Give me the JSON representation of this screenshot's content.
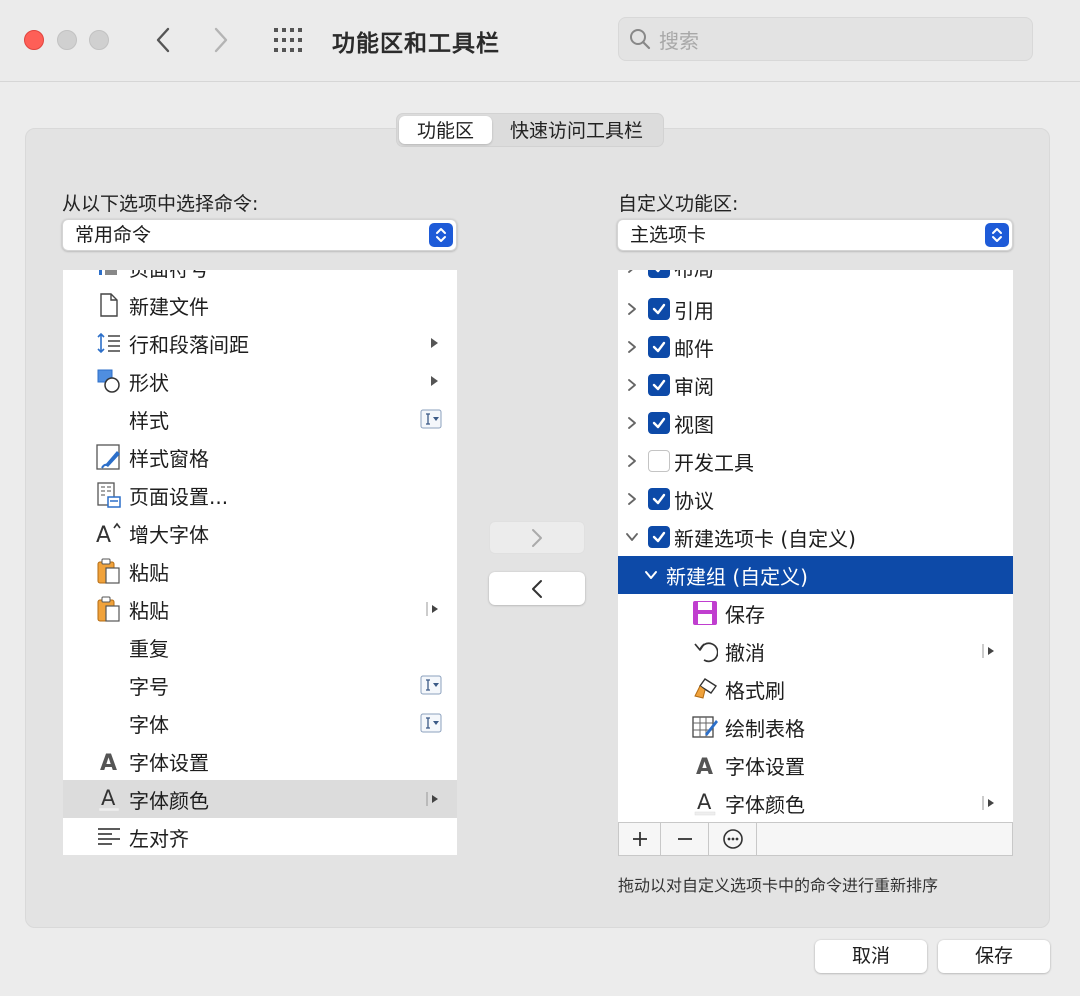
{
  "window": {
    "title": "功能区和工具栏",
    "search_placeholder": "搜索"
  },
  "tabs": [
    {
      "label": "功能区",
      "active": true
    },
    {
      "label": "快速访问工具栏",
      "active": false
    }
  ],
  "left": {
    "label": "从以下选项中选择命令:",
    "popup_value": "常用命令",
    "partial_top_item": "页面符号",
    "items": [
      {
        "label": "新建文件",
        "icon": "new-file-icon",
        "trailing": ""
      },
      {
        "label": "行和段落间距",
        "icon": "line-spacing-icon",
        "trailing": "submenu"
      },
      {
        "label": "形状",
        "icon": "shapes-icon",
        "trailing": "submenu"
      },
      {
        "label": "样式",
        "icon": "",
        "trailing": "combo"
      },
      {
        "label": "样式窗格",
        "icon": "styles-pane-icon",
        "trailing": ""
      },
      {
        "label": "页面设置...",
        "icon": "page-setup-icon",
        "trailing": ""
      },
      {
        "label": "增大字体",
        "icon": "grow-font-icon",
        "trailing": ""
      },
      {
        "label": "粘贴",
        "icon": "paste-icon",
        "trailing": ""
      },
      {
        "label": "粘贴",
        "icon": "paste-icon",
        "trailing": "split"
      },
      {
        "label": "重复",
        "icon": "",
        "trailing": ""
      },
      {
        "label": "字号",
        "icon": "",
        "trailing": "combo"
      },
      {
        "label": "字体",
        "icon": "",
        "trailing": "combo"
      },
      {
        "label": "字体设置",
        "icon": "font-settings-icon",
        "trailing": ""
      },
      {
        "label": "字体颜色",
        "icon": "font-color-icon",
        "trailing": "split",
        "highlighted": true
      },
      {
        "label": "左对齐",
        "icon": "align-left-icon",
        "trailing": ""
      }
    ]
  },
  "right": {
    "label": "自定义功能区:",
    "popup_value": "主选项卡",
    "partial_top_item": "布局",
    "tabs": [
      {
        "label": "引用",
        "checked": true
      },
      {
        "label": "邮件",
        "checked": true
      },
      {
        "label": "审阅",
        "checked": true
      },
      {
        "label": "视图",
        "checked": true
      },
      {
        "label": "开发工具",
        "checked": false
      },
      {
        "label": "协议",
        "checked": true
      },
      {
        "label": "新建选项卡 (自定义)",
        "checked": true,
        "expanded": true
      }
    ],
    "group_label": "新建组 (自定义)",
    "commands": [
      {
        "label": "保存",
        "icon": "save-icon",
        "trailing": ""
      },
      {
        "label": "撤消",
        "icon": "undo-icon",
        "trailing": "split"
      },
      {
        "label": "格式刷",
        "icon": "format-painter-icon",
        "trailing": ""
      },
      {
        "label": "绘制表格",
        "icon": "draw-table-icon",
        "trailing": ""
      },
      {
        "label": "字体设置",
        "icon": "font-settings-icon",
        "trailing": ""
      },
      {
        "label": "字体颜色",
        "icon": "font-color-icon",
        "trailing": "split"
      }
    ],
    "hint": "拖动以对自定义选项卡中的命令进行重新排序"
  },
  "buttons": {
    "cancel": "取消",
    "save": "保存"
  },
  "colors": {
    "accent": "#0d4aa8",
    "popup_arrow_bg": "#1e5bd8",
    "close": "#fe5f57"
  }
}
